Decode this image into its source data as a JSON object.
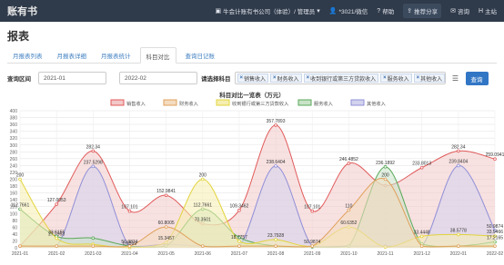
{
  "header": {
    "brand": "账有书",
    "company": "牛会计账有书公司（体验）/ 管理员",
    "user": "*3021/微信",
    "help": "帮助",
    "share": "推荐分享",
    "consult": "咨询",
    "home": "主站",
    "colors": {
      "bar": "#2f3a4a"
    }
  },
  "page": {
    "title": "报表"
  },
  "tabs": [
    {
      "label": "月报表列表"
    },
    {
      "label": "月报表详细"
    },
    {
      "label": "月报表统计"
    },
    {
      "label": "科目对比"
    },
    {
      "label": "查询日记账"
    }
  ],
  "filters": {
    "range_label": "查询区间",
    "start": "2021-01",
    "end": "2022-02",
    "subject_label": "请选择科目",
    "subjects": [
      {
        "label": "销售收入"
      },
      {
        "label": "财务收入"
      },
      {
        "label": "收到银行或第三方贷款收入"
      },
      {
        "label": "服务收入"
      },
      {
        "label": "其他收入"
      }
    ],
    "query_label": "查询",
    "list_icon": "list-icon"
  },
  "chart_data": {
    "type": "area",
    "title": "科目对比一览表（万元）",
    "categories": [
      "2021-01",
      "2021-02",
      "2021-03",
      "2021-04",
      "2021-05",
      "2021-06",
      "2021-07",
      "2021-08",
      "2021-09",
      "2021-10",
      "2021-11",
      "2021-12",
      "2022-01",
      "2022-02"
    ],
    "ylim": [
      0,
      400
    ],
    "yticks": [
      0,
      20,
      40,
      60,
      80,
      100,
      120,
      140,
      160,
      180,
      200,
      220,
      240,
      260,
      280,
      300,
      320,
      340,
      360,
      380,
      400
    ],
    "grid": true,
    "legend_position": "top-center",
    "series": [
      {
        "name": "销售收入",
        "color": "#e15a5a",
        "fill": "#f3c8c8",
        "values": [
          5,
          127.0053,
          282.34,
          107.101,
          152.9841,
          70.3501,
          109.3462,
          357.7893,
          107.101,
          246.4852,
          181.5,
          233.8013,
          282.34,
          259.0941
        ]
      },
      {
        "name": "财务收入",
        "color": "#e0a05a",
        "fill": "#f3dcc0",
        "values": [
          5,
          5,
          5,
          5,
          60.8005,
          5,
          5,
          5,
          5,
          110,
          200,
          5,
          5,
          5
        ]
      },
      {
        "name": "收到银行或第三方贷款收入",
        "color": "#e2d43c",
        "fill": "#f5eeb0",
        "values": [
          200,
          27.7953,
          10,
          0.6599,
          15.3457,
          200,
          18.7757,
          23.7928,
          5,
          60.6352,
          2.4,
          33.4448,
          38.5778,
          33.9466
        ]
      },
      {
        "name": "服务收入",
        "color": "#59a859",
        "fill": "#c8e3c8",
        "values": [
          112.7661,
          33.6155,
          28.2,
          5,
          5,
          112.7661,
          30.1763,
          5,
          2.6,
          5,
          236.1892,
          11.2,
          5,
          17.2165
        ]
      },
      {
        "name": "其他收入",
        "color": "#8f8fd8",
        "fill": "#d3d3ee",
        "values": [
          5,
          5,
          237.5298,
          5,
          10,
          5,
          5,
          238.6404,
          5,
          5,
          5,
          5,
          239.8404,
          50.9874
        ]
      }
    ],
    "labels": [
      {
        "series": 0,
        "i": 1,
        "text": "127.0053"
      },
      {
        "series": 0,
        "i": 2,
        "text": "282.34"
      },
      {
        "series": 0,
        "i": 3,
        "text": "107.101"
      },
      {
        "series": 0,
        "i": 4,
        "text": "152.9841"
      },
      {
        "series": 0,
        "i": 5,
        "text": "70.3501"
      },
      {
        "series": 0,
        "i": 6,
        "text": "109.3462"
      },
      {
        "series": 0,
        "i": 7,
        "text": "357.7893"
      },
      {
        "series": 0,
        "i": 8,
        "text": "107.101"
      },
      {
        "series": 0,
        "i": 9,
        "text": "246.4852"
      },
      {
        "series": 0,
        "i": 11,
        "text": "233.8013"
      },
      {
        "series": 0,
        "i": 12,
        "text": "282.34"
      },
      {
        "series": 0,
        "i": 13,
        "text": "259.0941"
      },
      {
        "series": 4,
        "i": 2,
        "text": "237.5298"
      },
      {
        "series": 4,
        "i": 7,
        "text": "238.6404"
      },
      {
        "series": 4,
        "i": 12,
        "text": "239.8404"
      },
      {
        "series": 4,
        "i": 13,
        "text": "50.9874"
      },
      {
        "series": 3,
        "i": 0,
        "text": "112.7661"
      },
      {
        "series": 3,
        "i": 5,
        "text": "112.7661"
      },
      {
        "series": 3,
        "i": 10,
        "text": "236.1892"
      },
      {
        "series": 2,
        "i": 0,
        "text": "200"
      },
      {
        "series": 2,
        "i": 5,
        "text": "200"
      },
      {
        "series": 1,
        "i": 10,
        "text": "200"
      },
      {
        "series": 1,
        "i": 9,
        "text": "110"
      },
      {
        "series": 1,
        "i": 4,
        "text": "60.8005"
      },
      {
        "series": 2,
        "i": 9,
        "text": "60.6352"
      },
      {
        "series": 4,
        "i": 3,
        "text": "50.9874"
      },
      {
        "series": 4,
        "i": 8,
        "text": "50.9874"
      },
      {
        "series": 2,
        "i": 1,
        "text": "27.7953"
      },
      {
        "series": 3,
        "i": 1,
        "text": "33.6155"
      },
      {
        "series": 2,
        "i": 11,
        "text": "33.4448"
      },
      {
        "series": 2,
        "i": 12,
        "text": "38.5778"
      },
      {
        "series": 2,
        "i": 13,
        "text": "33.9466"
      },
      {
        "series": 2,
        "i": 6,
        "text": "18.7757"
      },
      {
        "series": 2,
        "i": 7,
        "text": "23.7928"
      },
      {
        "series": 3,
        "i": 13,
        "text": "17.2165"
      },
      {
        "series": 2,
        "i": 4,
        "text": "15.3457"
      },
      {
        "series": 2,
        "i": 3,
        "text": "0.6599"
      }
    ]
  }
}
